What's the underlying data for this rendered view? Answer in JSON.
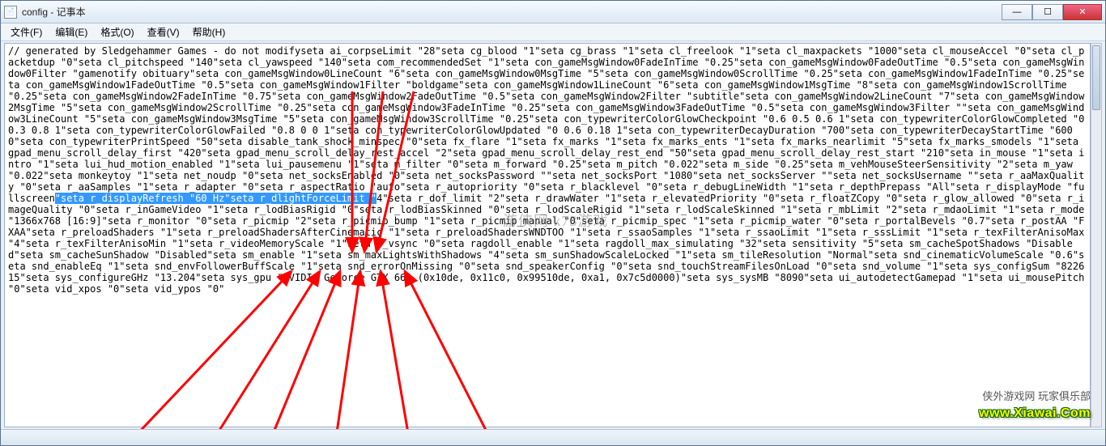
{
  "window": {
    "title": "config - 记事本",
    "buttons": {
      "min": "—",
      "max": "☐",
      "close": "✕"
    }
  },
  "menu": {
    "file": "文件(F)",
    "edit": "编辑(E)",
    "format": "格式(O)",
    "view": "查看(V)",
    "help": "帮助(H)"
  },
  "content": {
    "pre": "// generated by Sledgehammer Games - do not modifyseta ai_corpseLimit \"28\"seta cg_blood \"1\"seta cg_brass \"1\"seta cl_freelook \"1\"seta cl_maxpackets \"1000\"seta cl_mouseAccel \"0\"seta cl_packetdup \"0\"seta cl_pitchspeed \"140\"seta cl_yawspeed \"140\"seta com_recommendedSet \"1\"seta con_gameMsgWindow0FadeInTime \"0.25\"seta con_gameMsgWindow0FadeOutTime \"0.5\"seta con_gameMsgWindow0Filter \"gamenotify obituary\"seta con_gameMsgWindow0LineCount \"6\"seta con_gameMsgWindow0MsgTime \"5\"seta con_gameMsgWindow0ScrollTime \"0.25\"seta con_gameMsgWindow1FadeInTime \"0.25\"seta con_gameMsgWindow1FadeOutTime \"0.5\"seta con_gameMsgWindow1Filter \"boldgame\"seta con_gameMsgWindow1LineCount \"6\"seta con_gameMsgWindow1MsgTime \"8\"seta con_gameMsgWindow1ScrollTime \"0.25\"seta con_gameMsgWindow2FadeInTime \"0.75\"seta con_gameMsgWindow2FadeOutTime \"0.5\"seta con_gameMsgWindow2Filter \"subtitle\"seta con_gameMsgWindow2LineCount \"7\"seta con_gameMsgWindow2MsgTime \"5\"seta con_gameMsgWindow2ScrollTime \"0.25\"seta con_gameMsgWindow3FadeInTime \"0.25\"seta con_gameMsgWindow3FadeOutTime \"0.5\"seta con_gameMsgWindow3Filter \"\"seta con_gameMsgWindow3LineCount \"5\"seta con_gameMsgWindow3MsgTime \"5\"seta con_gameMsgWindow3ScrollTime \"0.25\"seta con_typewriterColorGlowCheckpoint \"0.6 0.5 0.6 1\"seta con_typewriterColorGlowCompleted \"0 0.3 0.8 1\"seta con_typewriterColorGlowFailed \"0.8 0 0 1\"seta con_typewriterColorGlowUpdated \"0 0.6 0.18 1\"seta con_typewriterDecayDuration \"700\"seta con_typewriterDecayStartTime \"6000\"seta con_typewriterPrintSpeed \"50\"seta disable_tank_shock_minspec \"0\"seta fx_flare \"1\"seta fx_marks \"1\"seta fx_marks_ents \"1\"seta fx_marks_nearlimit \"5\"seta fx_marks_smodels \"1\"seta gpad_menu_scroll_delay_first \"420\"seta gpad_menu_scroll_delay_rest_accel \"2\"seta gpad_menu_scroll_delay_rest_end \"50\"seta gpad_menu_scroll_delay_rest_start \"210\"seta in_mouse \"1\"seta intro \"1\"seta lui_hud_motion_enabled \"1\"seta lui_pausemenu \"1\"seta m_filter \"0\"seta m_forward \"0.25\"seta m_pitch \"0.022\"seta m_side \"0.25\"seta m_vehMouseSteerSensitivity \"2\"seta m_yaw \"0.022\"seta monkeytoy \"1\"seta net_noudp \"0\"seta net_socksEnabled \"0\"seta net_socksPassword \"\"seta net_socksPort \"1080\"seta net_socksServer \"\"seta net_socksUsername \"\"seta r_aaMaxQuality \"0\"seta r_aaSamples \"1\"seta r_adapter \"0\"seta r_aspectRatio \"auto\"seta r_autopriority \"0\"seta r_blacklevel \"0\"seta r_debugLineWidth \"1\"seta r_depthPrepass \"All\"seta r_displayMode \"fullscreen",
    "sel": "\"seta r_displayRefresh \"60 Hz\"seta r_dlightForceLimit \"",
    "post": "4\"seta r_dof_limit \"2\"seta r_drawWater \"1\"seta r_elevatedPriority \"0\"seta r_floatZCopy \"0\"seta r_glow_allowed \"0\"seta r_imageQuality \"0\"seta r_inGameVideo \"1\"seta r_lodBiasRigid \"0\"seta r_lodBiasSkinned \"0\"seta r_lodScaleRigid \"1\"seta r_lodScaleSkinned \"1\"seta r_mbLimit \"2\"seta r_mdaoLimit \"1\"seta r_mode \"1366x768 [16:9]\"seta r_monitor \"0\"seta r_picmip \"2\"seta r_picmip_bump \"1\"seta r_picmip_manual \"0\"seta r_picmip_spec \"1\"seta r_picmip_water \"0\"seta r_portalBevels \"0.7\"seta r_postAA \"FXAA\"seta r_preloadShaders \"1\"seta r_preloadShadersAfterCinematic \"1\"seta r_preloadShadersWNDTOO \"1\"seta r_ssaoSamples \"1\"seta r_ssaoLimit \"1\"seta r_sssLimit \"1\"seta r_texFilterAnisoMax \"4\"seta r_texFilterAnisoMin \"1\"seta r_videoMemoryScale \"1\"seta r_vsync \"0\"seta ragdoll_enable \"1\"seta ragdoll_max_simulating \"32\"seta sensitivity \"5\"seta sm_cacheSpotShadows \"Disabled\"seta sm_cacheSunShadow \"Disabled\"seta sm_enable \"1\"seta sm_maxLightsWithShadows \"4\"seta sm_sunShadowScaleLocked \"1\"seta sm_tileResolution \"Normal\"seta snd_cinematicVolumeScale \"0.6\"seta snd_enableEq \"1\"seta snd_envFollowerBuffScale \"1\"seta snd_errorOnMissing \"0\"seta snd_speakerConfig \"0\"seta snd_touchStreamFilesOnLoad \"0\"seta snd_volume \"1\"seta sys_configSum \"822615\"seta sys_configureGHz \"13.204\"seta sys_gpu \"NVIDIA GeForce GTX 660   (0x10de, 0x11c0, 0x99510de, 0xa1, 0x7c5d0000)\"seta sys_sysMB \"8090\"seta ui_autodetectGamepad \"1\"seta ui_mousePitch \"0\"seta vid_xpos \"0\"seta vid_ypos \"0\""
  },
  "watermarks": {
    "mid": "游侠网 k73游戏",
    "cn_label": "侠外游戏网      玩家俱乐部",
    "site": "www.Xiawai.Com"
  },
  "statusbar": {
    "text": ""
  }
}
